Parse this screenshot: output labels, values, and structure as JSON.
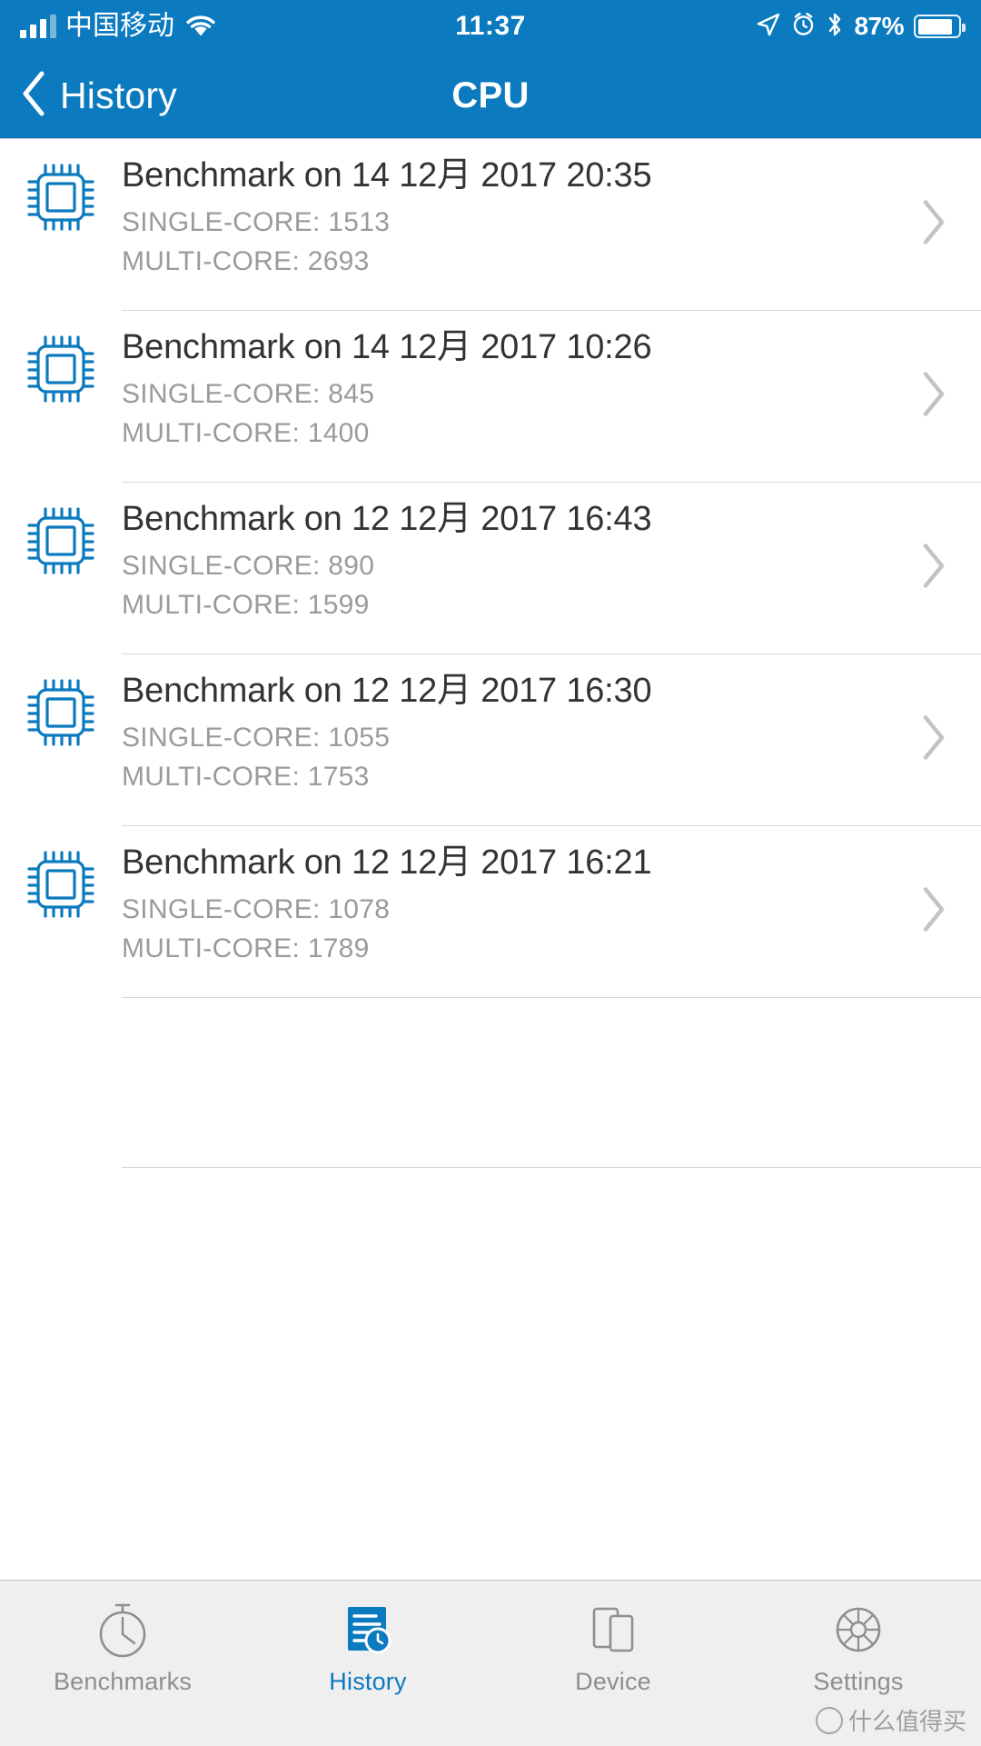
{
  "status_bar": {
    "carrier": "中国移动",
    "time": "11:37",
    "battery_percent": "87%",
    "icons": {
      "signal": "signal-bars-icon",
      "wifi": "wifi-icon",
      "location": "location-arrow-icon",
      "alarm": "alarm-clock-icon",
      "bluetooth": "bluetooth-icon",
      "battery": "battery-icon"
    }
  },
  "nav_bar": {
    "back_label": "History",
    "title": "CPU",
    "back_icon": "chevron-left-icon",
    "background_color": "#0b7abf"
  },
  "colors": {
    "accent": "#0b7abf",
    "title_text": "#333333",
    "subtitle_text": "#9b9b9b",
    "separator": "#d6d6d6",
    "tab_bar_bg": "#efeff0",
    "tab_inactive": "#8e8e93"
  },
  "list": {
    "row_icon": "cpu-chip-icon",
    "disclosure_icon": "chevron-right-icon",
    "items": [
      {
        "title": "Benchmark on 14 12月 2017 20:35",
        "single_core": "SINGLE-CORE: 1513",
        "multi_core": "MULTI-CORE: 2693"
      },
      {
        "title": "Benchmark on 14 12月 2017 10:26",
        "single_core": "SINGLE-CORE: 845",
        "multi_core": "MULTI-CORE: 1400"
      },
      {
        "title": "Benchmark on 12 12月 2017 16:43",
        "single_core": "SINGLE-CORE: 890",
        "multi_core": "MULTI-CORE: 1599"
      },
      {
        "title": "Benchmark on 12 12月 2017 16:30",
        "single_core": "SINGLE-CORE: 1055",
        "multi_core": "MULTI-CORE: 1753"
      },
      {
        "title": "Benchmark on 12 12月 2017 16:21",
        "single_core": "SINGLE-CORE: 1078",
        "multi_core": "MULTI-CORE: 1789"
      }
    ]
  },
  "tab_bar": {
    "tabs": [
      {
        "label": "Benchmarks",
        "icon": "stopwatch-icon",
        "active": false
      },
      {
        "label": "History",
        "icon": "history-document-clock-icon",
        "active": true
      },
      {
        "label": "Device",
        "icon": "devices-icon",
        "active": false
      },
      {
        "label": "Settings",
        "icon": "gear-icon",
        "active": false
      }
    ]
  },
  "watermark": {
    "text": "什么值得买"
  }
}
